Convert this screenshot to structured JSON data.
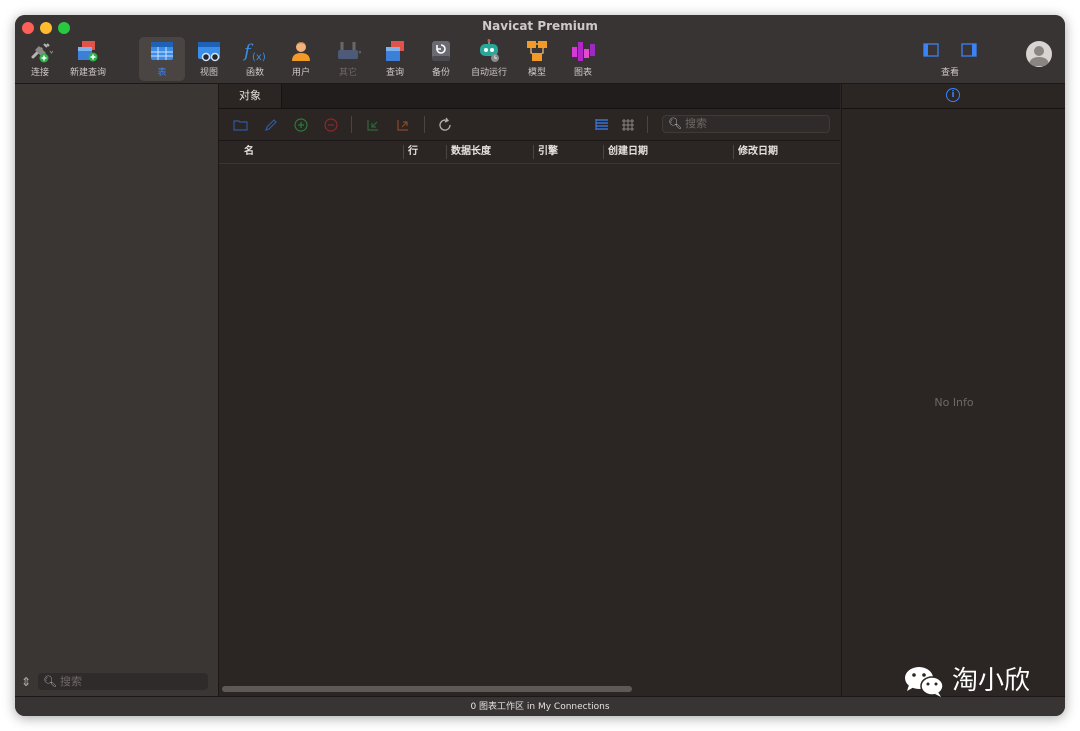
{
  "window": {
    "title": "Navicat Premium"
  },
  "toolbar": {
    "connect": "连接",
    "new_query": "新建查询",
    "table": "表",
    "view": "视图",
    "function": "函数",
    "user": "用户",
    "other": "其它",
    "query": "查询",
    "backup": "备份",
    "automation": "自动运行",
    "model": "模型",
    "chart": "图表",
    "view_menu": "查看"
  },
  "colors": {
    "accent": "#3b82f6",
    "background": "#2b2523"
  },
  "sidebar": {
    "search_placeholder": "搜索"
  },
  "main": {
    "tab_label": "对象",
    "search_placeholder": "搜索",
    "columns": [
      "名",
      "行",
      "数据长度",
      "引擎",
      "创建日期",
      "修改日期"
    ]
  },
  "info_panel": {
    "empty_text": "No Info"
  },
  "status": {
    "text": "0 图表工作区 in My Connections"
  },
  "watermark": {
    "text": "淘小欣"
  }
}
